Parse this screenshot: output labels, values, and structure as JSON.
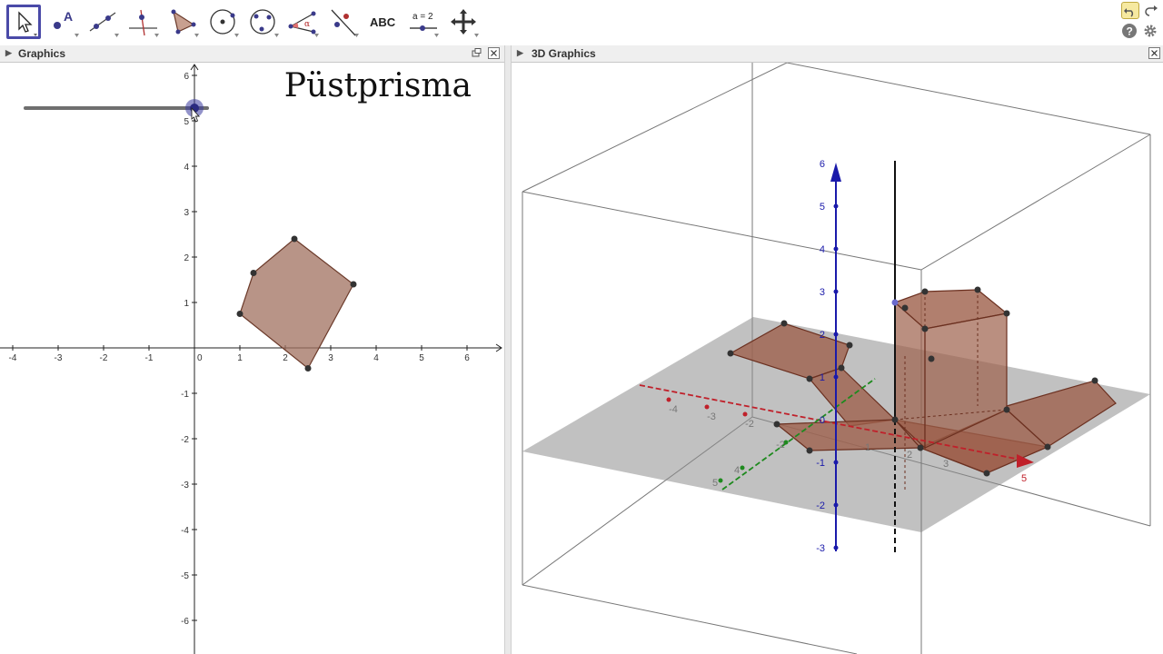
{
  "toolbar": {
    "tools": [
      {
        "name": "move-tool-button",
        "icon": "cursor-arrow-icon"
      },
      {
        "name": "point-tool-button",
        "icon": "point-icon"
      },
      {
        "name": "line-tool-button",
        "icon": "line-icon"
      },
      {
        "name": "perpendicular-tool-button",
        "icon": "perpendicular-line-icon"
      },
      {
        "name": "polygon-tool-button",
        "icon": "polygon-icon"
      },
      {
        "name": "circle-tool-button",
        "icon": "circle-icon"
      },
      {
        "name": "conic-tool-button",
        "icon": "ellipse-icon"
      },
      {
        "name": "angle-tool-button",
        "icon": "angle-icon"
      },
      {
        "name": "reflect-tool-button",
        "icon": "reflect-icon"
      },
      {
        "name": "text-tool-button",
        "icon": "text-abc-icon",
        "label": "ABC"
      },
      {
        "name": "slider-tool-button",
        "icon": "slider-icon",
        "label": "a = 2"
      },
      {
        "name": "move-view-tool-button",
        "icon": "move-view-icon"
      }
    ]
  },
  "panels": {
    "graphics": {
      "title": "Graphics"
    },
    "graphics3d": {
      "title": "3D Graphics"
    }
  },
  "graphics": {
    "heading": "Püstprisma",
    "x_ticks": [
      "-4",
      "-3",
      "-2",
      "-1",
      "0",
      "1",
      "2",
      "3",
      "4",
      "5",
      "6"
    ],
    "y_ticks": [
      "6",
      "5",
      "4",
      "3",
      "2",
      "1",
      "0",
      "-1",
      "-2",
      "-3",
      "-4",
      "-5",
      "-6"
    ],
    "polygon_vertices": [
      [
        2.2,
        2.4
      ],
      [
        3.5,
        1.4
      ],
      [
        2.5,
        -0.45
      ],
      [
        1.0,
        0.75
      ],
      [
        1.3,
        1.65
      ]
    ],
    "slider_value": 1
  },
  "graphics3d": {
    "z_ticks": [
      "6",
      "5",
      "4",
      "3",
      "2",
      "1",
      "0",
      "-1",
      "-2",
      "-3"
    ],
    "x_ticks_neg": [
      "-4",
      "-3",
      "-2"
    ],
    "x_ticks_pos": [
      "1",
      "2",
      "3",
      "5"
    ],
    "y_ticks": [
      "-2",
      "4",
      "5"
    ]
  },
  "colors": {
    "accent": "#4a4aa8",
    "polygon_fill": "#a0705f",
    "axis_z": "#1a1aaa",
    "axis_x": "#c0202a",
    "axis_y": "#1e8a1e"
  }
}
